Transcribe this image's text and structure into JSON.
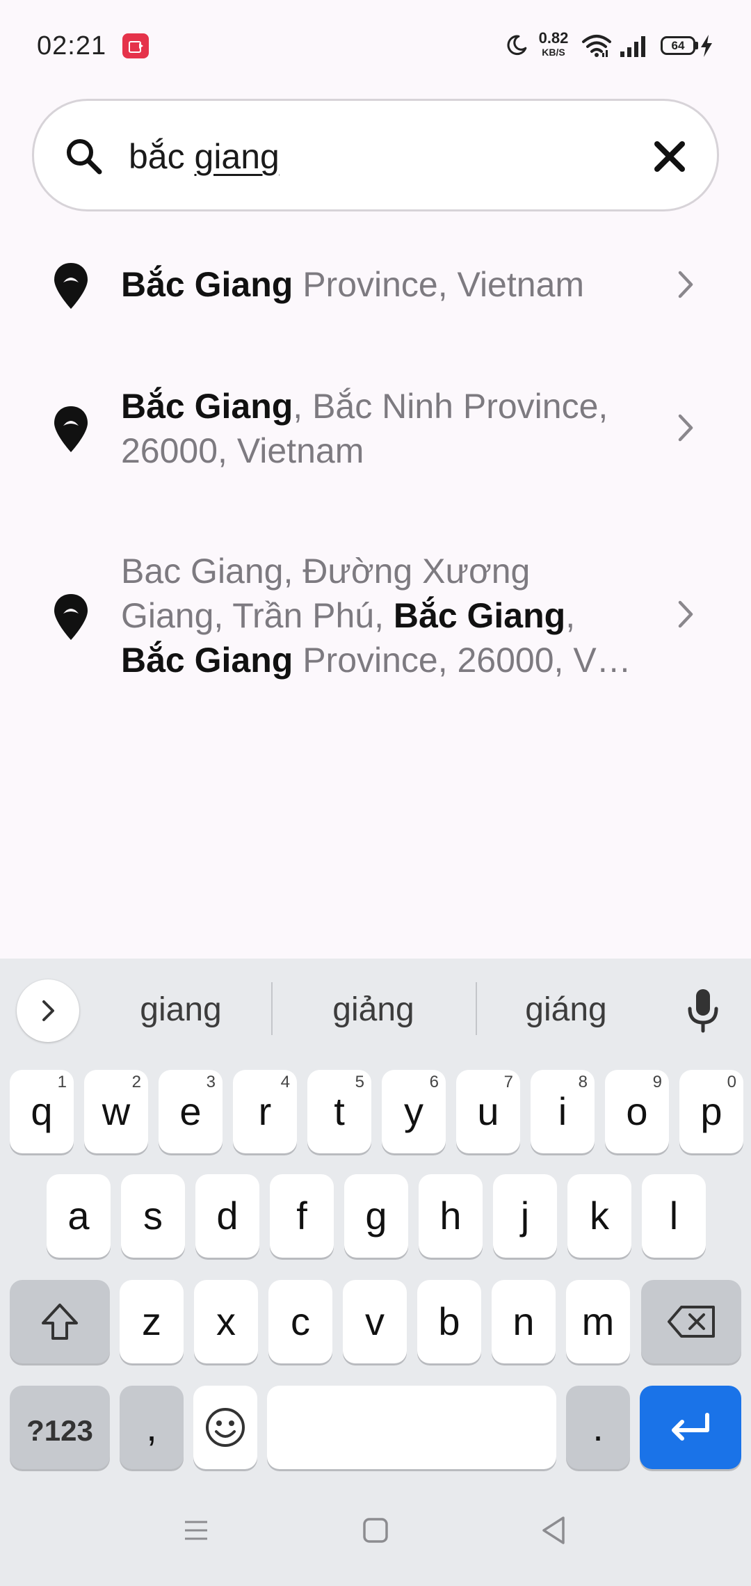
{
  "status_bar": {
    "time": "02:21",
    "net_speed_value": "0.82",
    "net_speed_unit": "KB/S",
    "battery_level": "64",
    "icons": [
      "screen-record-icon",
      "moon-icon",
      "wifi-icon",
      "signal-icon",
      "battery-icon",
      "charging-bolt-icon"
    ],
    "record_color": "#e5334a"
  },
  "search": {
    "query_prefix": "bắc ",
    "query_composing": "giang",
    "icon": "search-icon",
    "clear_icon": "close-icon"
  },
  "results": [
    {
      "icon": "location-pin-icon",
      "parts": [
        {
          "text": "Bắc Giang",
          "bold": true
        },
        {
          "text": " Province, Vietnam",
          "bold": false
        }
      ]
    },
    {
      "icon": "location-pin-icon",
      "parts": [
        {
          "text": "Bắc Giang",
          "bold": true
        },
        {
          "text": ", Bắc Ninh Province, 26000, Vietnam",
          "bold": false
        }
      ]
    },
    {
      "icon": "location-pin-icon",
      "parts": [
        {
          "text": "Bac Giang, Đường Xương Giang, Trần Phú, ",
          "bold": false
        },
        {
          "text": "Bắc Giang",
          "bold": true
        },
        {
          "text": ", ",
          "bold": false
        },
        {
          "text": "Bắc Giang",
          "bold": true
        },
        {
          "text": " Province, 26000, V…",
          "bold": false
        }
      ]
    }
  ],
  "keyboard": {
    "suggestions": [
      "giang",
      "giảng",
      "giáng"
    ],
    "row1": [
      {
        "key": "q",
        "hint": "1"
      },
      {
        "key": "w",
        "hint": "2"
      },
      {
        "key": "e",
        "hint": "3"
      },
      {
        "key": "r",
        "hint": "4"
      },
      {
        "key": "t",
        "hint": "5"
      },
      {
        "key": "y",
        "hint": "6"
      },
      {
        "key": "u",
        "hint": "7"
      },
      {
        "key": "i",
        "hint": "8"
      },
      {
        "key": "o",
        "hint": "9"
      },
      {
        "key": "p",
        "hint": "0"
      }
    ],
    "row2": [
      "a",
      "s",
      "d",
      "f",
      "g",
      "h",
      "j",
      "k",
      "l"
    ],
    "row3": [
      "z",
      "x",
      "c",
      "v",
      "b",
      "n",
      "m"
    ],
    "symbols_label": "?123",
    "comma_label": ",",
    "period_label": ".",
    "enter_color": "#1a73e8"
  },
  "navbar": {
    "icons": [
      "menu-icon",
      "home-icon",
      "back-icon"
    ]
  }
}
